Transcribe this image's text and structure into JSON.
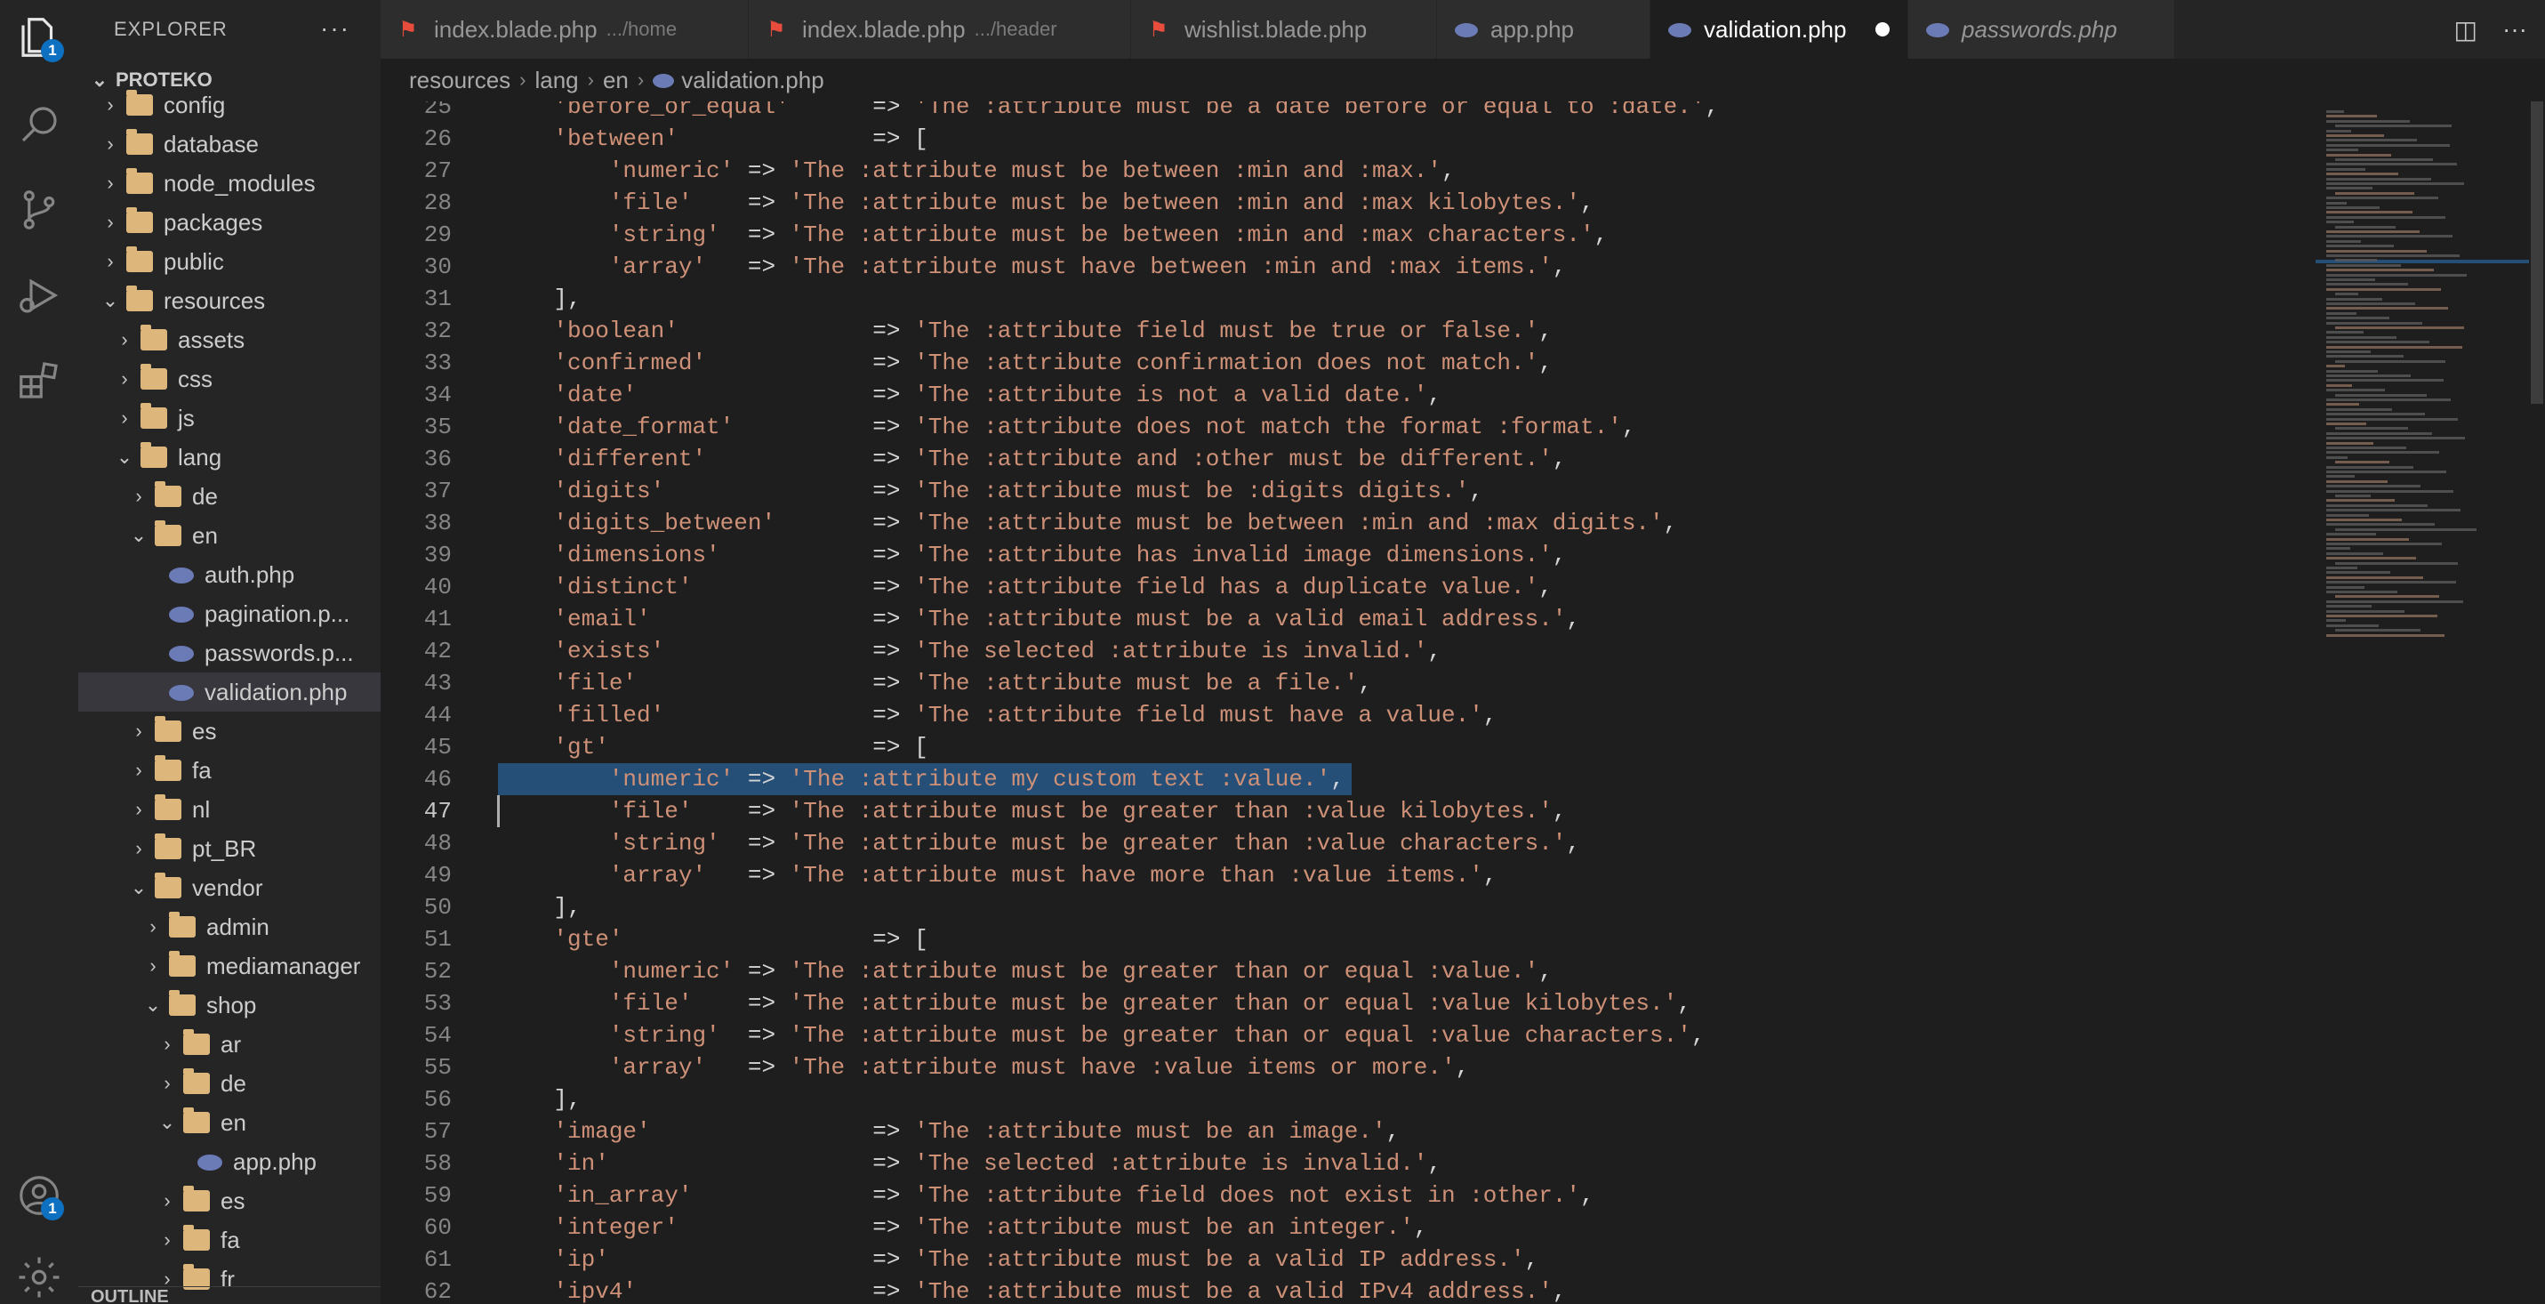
{
  "activity_bar": {
    "explorer_badge": "1",
    "accounts_badge": "1"
  },
  "explorer": {
    "title": "EXPLORER",
    "more": "···",
    "project": "PROTEKO",
    "items": [
      {
        "label": "config",
        "type": "folder",
        "depth": 1,
        "open": false
      },
      {
        "label": "database",
        "type": "folder",
        "depth": 1,
        "open": false
      },
      {
        "label": "node_modules",
        "type": "folder",
        "depth": 1,
        "open": false
      },
      {
        "label": "packages",
        "type": "folder",
        "depth": 1,
        "open": false
      },
      {
        "label": "public",
        "type": "folder",
        "depth": 1,
        "open": false
      },
      {
        "label": "resources",
        "type": "folder",
        "depth": 1,
        "open": true
      },
      {
        "label": "assets",
        "type": "folder",
        "depth": 2,
        "open": false
      },
      {
        "label": "css",
        "type": "folder",
        "depth": 2,
        "open": false
      },
      {
        "label": "js",
        "type": "folder",
        "depth": 2,
        "open": false
      },
      {
        "label": "lang",
        "type": "folder",
        "depth": 2,
        "open": true
      },
      {
        "label": "de",
        "type": "folder",
        "depth": 3,
        "open": false
      },
      {
        "label": "en",
        "type": "folder",
        "depth": 3,
        "open": true
      },
      {
        "label": "auth.php",
        "type": "file",
        "depth": 4
      },
      {
        "label": "pagination.p...",
        "type": "file",
        "depth": 4
      },
      {
        "label": "passwords.p...",
        "type": "file",
        "depth": 4
      },
      {
        "label": "validation.php",
        "type": "file",
        "depth": 4,
        "selected": true
      },
      {
        "label": "es",
        "type": "folder",
        "depth": 3,
        "open": false
      },
      {
        "label": "fa",
        "type": "folder",
        "depth": 3,
        "open": false
      },
      {
        "label": "nl",
        "type": "folder",
        "depth": 3,
        "open": false
      },
      {
        "label": "pt_BR",
        "type": "folder",
        "depth": 3,
        "open": false
      },
      {
        "label": "vendor",
        "type": "folder",
        "depth": 3,
        "open": true
      },
      {
        "label": "admin",
        "type": "folder",
        "depth": 4,
        "open": false
      },
      {
        "label": "mediamanager",
        "type": "folder",
        "depth": 4,
        "open": false
      },
      {
        "label": "shop",
        "type": "folder",
        "depth": 4,
        "open": true
      },
      {
        "label": "ar",
        "type": "folder",
        "depth": 5,
        "open": false
      },
      {
        "label": "de",
        "type": "folder",
        "depth": 5,
        "open": false
      },
      {
        "label": "en",
        "type": "folder",
        "depth": 5,
        "open": true
      },
      {
        "label": "app.php",
        "type": "file",
        "depth": 6
      },
      {
        "label": "es",
        "type": "folder",
        "depth": 5,
        "open": false
      },
      {
        "label": "fa",
        "type": "folder",
        "depth": 5,
        "open": false
      },
      {
        "label": "fr",
        "type": "folder",
        "depth": 5,
        "open": false
      }
    ],
    "outline": "OUTLINE"
  },
  "tabs": [
    {
      "label": "index.blade.php",
      "desc": ".../home",
      "icon": "laravel-icon",
      "active": false
    },
    {
      "label": "index.blade.php",
      "desc": ".../header",
      "icon": "laravel-icon",
      "active": false
    },
    {
      "label": "wishlist.blade.php",
      "desc": "",
      "icon": "laravel-icon",
      "active": false
    },
    {
      "label": "app.php",
      "desc": "",
      "icon": "php-icon",
      "active": false
    },
    {
      "label": "validation.php",
      "desc": "",
      "icon": "php-icon",
      "active": true,
      "dirty": true
    },
    {
      "label": "passwords.php",
      "desc": "",
      "icon": "php-icon",
      "active": false,
      "italic": true
    }
  ],
  "breadcrumb": [
    "resources",
    "lang",
    "en",
    "validation.php"
  ],
  "editor": {
    "current_line": 47,
    "selected_line": 46,
    "lines": [
      {
        "n": 25,
        "text": "    'before_or_equal'      => 'The :attribute must be a date before or equal to :date.',"
      },
      {
        "n": 26,
        "text": "    'between'              => ["
      },
      {
        "n": 27,
        "text": "        'numeric' => 'The :attribute must be between :min and :max.',"
      },
      {
        "n": 28,
        "text": "        'file'    => 'The :attribute must be between :min and :max kilobytes.',"
      },
      {
        "n": 29,
        "text": "        'string'  => 'The :attribute must be between :min and :max characters.',"
      },
      {
        "n": 30,
        "text": "        'array'   => 'The :attribute must have between :min and :max items.',"
      },
      {
        "n": 31,
        "text": "    ],"
      },
      {
        "n": 32,
        "text": "    'boolean'              => 'The :attribute field must be true or false.',"
      },
      {
        "n": 33,
        "text": "    'confirmed'            => 'The :attribute confirmation does not match.',"
      },
      {
        "n": 34,
        "text": "    'date'                 => 'The :attribute is not a valid date.',"
      },
      {
        "n": 35,
        "text": "    'date_format'          => 'The :attribute does not match the format :format.',"
      },
      {
        "n": 36,
        "text": "    'different'            => 'The :attribute and :other must be different.',"
      },
      {
        "n": 37,
        "text": "    'digits'               => 'The :attribute must be :digits digits.',"
      },
      {
        "n": 38,
        "text": "    'digits_between'       => 'The :attribute must be between :min and :max digits.',"
      },
      {
        "n": 39,
        "text": "    'dimensions'           => 'The :attribute has invalid image dimensions.',"
      },
      {
        "n": 40,
        "text": "    'distinct'             => 'The :attribute field has a duplicate value.',"
      },
      {
        "n": 41,
        "text": "    'email'                => 'The :attribute must be a valid email address.',"
      },
      {
        "n": 42,
        "text": "    'exists'               => 'The selected :attribute is invalid.',"
      },
      {
        "n": 43,
        "text": "    'file'                 => 'The :attribute must be a file.',"
      },
      {
        "n": 44,
        "text": "    'filled'               => 'The :attribute field must have a value.',"
      },
      {
        "n": 45,
        "text": "    'gt'                   => ["
      },
      {
        "n": 46,
        "text": "        'numeric' => 'The :attribute my custom text :value.',"
      },
      {
        "n": 47,
        "text": "        'file'    => 'The :attribute must be greater than :value kilobytes.',"
      },
      {
        "n": 48,
        "text": "        'string'  => 'The :attribute must be greater than :value characters.',"
      },
      {
        "n": 49,
        "text": "        'array'   => 'The :attribute must have more than :value items.',"
      },
      {
        "n": 50,
        "text": "    ],"
      },
      {
        "n": 51,
        "text": "    'gte'                  => ["
      },
      {
        "n": 52,
        "text": "        'numeric' => 'The :attribute must be greater than or equal :value.',"
      },
      {
        "n": 53,
        "text": "        'file'    => 'The :attribute must be greater than or equal :value kilobytes.',"
      },
      {
        "n": 54,
        "text": "        'string'  => 'The :attribute must be greater than or equal :value characters.',"
      },
      {
        "n": 55,
        "text": "        'array'   => 'The :attribute must have :value items or more.',"
      },
      {
        "n": 56,
        "text": "    ],"
      },
      {
        "n": 57,
        "text": "    'image'                => 'The :attribute must be an image.',"
      },
      {
        "n": 58,
        "text": "    'in'                   => 'The selected :attribute is invalid.',"
      },
      {
        "n": 59,
        "text": "    'in_array'             => 'The :attribute field does not exist in :other.',"
      },
      {
        "n": 60,
        "text": "    'integer'              => 'The :attribute must be an integer.',"
      },
      {
        "n": 61,
        "text": "    'ip'                   => 'The :attribute must be a valid IP address.',"
      },
      {
        "n": 62,
        "text": "    'ipv4'                 => 'The :attribute must be a valid IPv4 address.',"
      }
    ]
  },
  "colors": {
    "string": "#ce9178",
    "selection": "#264f78",
    "accent": "#0e70c0"
  }
}
